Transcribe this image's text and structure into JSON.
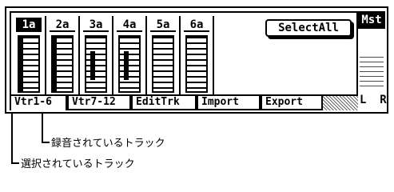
{
  "tracks": [
    {
      "label": "1a",
      "selected": true,
      "recording": true
    },
    {
      "label": "2a",
      "selected": false,
      "recording": true
    },
    {
      "label": "3a",
      "selected": false,
      "recording": false
    },
    {
      "label": "4a",
      "selected": false,
      "recording": false
    },
    {
      "label": "5a",
      "selected": false,
      "recording": false
    },
    {
      "label": "6a",
      "selected": false,
      "recording": false
    }
  ],
  "select_all_label": "SelectAll",
  "master": {
    "label": "Mst",
    "left": "L",
    "right": "R"
  },
  "tabs": [
    {
      "label": "Vtr1-6",
      "active": true
    },
    {
      "label": "Vtr7-12",
      "active": false
    },
    {
      "label": "EditTrk",
      "active": false
    },
    {
      "label": "Import",
      "active": false
    },
    {
      "label": "Export",
      "active": false
    }
  ],
  "annotations": {
    "recording_track": "録音されているトラック",
    "selected_track": "選択されているトラック"
  }
}
